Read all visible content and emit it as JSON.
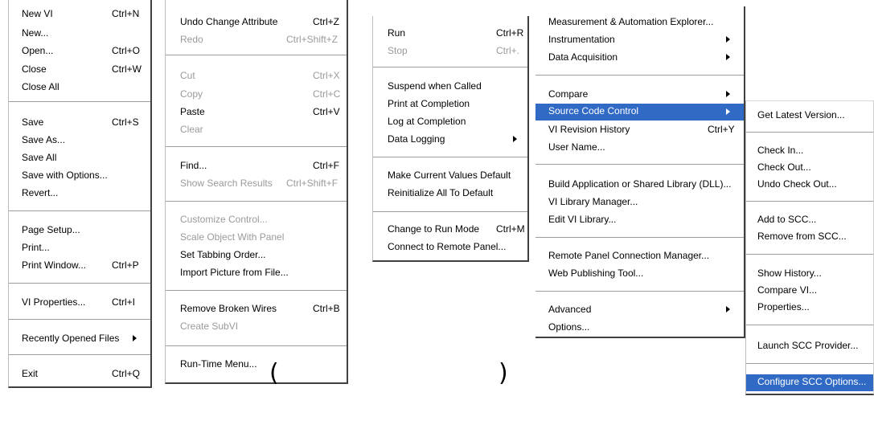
{
  "menus": {
    "file": {
      "items": [
        {
          "label": "New VI",
          "shortcut": "Ctrl+N"
        },
        {
          "label": "New...",
          "shortcut": ""
        },
        {
          "label": "Open...",
          "shortcut": "Ctrl+O"
        },
        {
          "label": "Close",
          "shortcut": "Ctrl+W"
        },
        {
          "label": "Close All",
          "shortcut": ""
        },
        {
          "label": "Save",
          "shortcut": "Ctrl+S"
        },
        {
          "label": "Save As...",
          "shortcut": ""
        },
        {
          "label": "Save All",
          "shortcut": ""
        },
        {
          "label": "Save with Options...",
          "shortcut": ""
        },
        {
          "label": "Revert...",
          "shortcut": ""
        },
        {
          "label": "Page Setup...",
          "shortcut": ""
        },
        {
          "label": "Print...",
          "shortcut": ""
        },
        {
          "label": "Print Window...",
          "shortcut": "Ctrl+P"
        },
        {
          "label": "VI Properties...",
          "shortcut": "Ctrl+I"
        },
        {
          "label": "Recently Opened Files",
          "shortcut": ""
        },
        {
          "label": "Exit",
          "shortcut": "Ctrl+Q"
        }
      ]
    },
    "edit": {
      "items": [
        {
          "label": "Undo Change Attribute",
          "shortcut": "Ctrl+Z"
        },
        {
          "label": "Redo",
          "shortcut": "Ctrl+Shift+Z"
        },
        {
          "label": "Cut",
          "shortcut": "Ctrl+X"
        },
        {
          "label": "Copy",
          "shortcut": "Ctrl+C"
        },
        {
          "label": "Paste",
          "shortcut": "Ctrl+V"
        },
        {
          "label": "Clear",
          "shortcut": ""
        },
        {
          "label": "Find...",
          "shortcut": "Ctrl+F"
        },
        {
          "label": "Show Search Results",
          "shortcut": "Ctrl+Shift+F"
        },
        {
          "label": "Customize Control...",
          "shortcut": ""
        },
        {
          "label": "Scale Object With Panel",
          "shortcut": ""
        },
        {
          "label": "Set Tabbing Order...",
          "shortcut": ""
        },
        {
          "label": "Import Picture from File...",
          "shortcut": ""
        },
        {
          "label": "Remove Broken Wires",
          "shortcut": "Ctrl+B"
        },
        {
          "label": "Create SubVI",
          "shortcut": ""
        },
        {
          "label": "Run-Time Menu...",
          "shortcut": ""
        }
      ]
    },
    "operate": {
      "items": [
        {
          "label": "Run",
          "shortcut": "Ctrl+R"
        },
        {
          "label": "Stop",
          "shortcut": "Ctrl+."
        },
        {
          "label": "Suspend when Called",
          "shortcut": ""
        },
        {
          "label": "Print at Completion",
          "shortcut": ""
        },
        {
          "label": "Log at Completion",
          "shortcut": ""
        },
        {
          "label": "Data Logging",
          "shortcut": ""
        },
        {
          "label": "Make Current Values Default",
          "shortcut": ""
        },
        {
          "label": "Reinitialize All To Default",
          "shortcut": ""
        },
        {
          "label": "Change to Run Mode",
          "shortcut": "Ctrl+M"
        },
        {
          "label": "Connect to Remote Panel...",
          "shortcut": ""
        }
      ]
    },
    "tools": {
      "items": [
        {
          "label": "Measurement & Automation Explorer...",
          "shortcut": ""
        },
        {
          "label": "Instrumentation",
          "shortcut": ""
        },
        {
          "label": "Data Acquisition",
          "shortcut": ""
        },
        {
          "label": "Compare",
          "shortcut": ""
        },
        {
          "label": "Source Code Control",
          "shortcut": ""
        },
        {
          "label": "VI Revision History",
          "shortcut": "Ctrl+Y"
        },
        {
          "label": "User Name...",
          "shortcut": ""
        },
        {
          "label": "Build Application or Shared Library (DLL)...",
          "shortcut": ""
        },
        {
          "label": "VI Library Manager...",
          "shortcut": ""
        },
        {
          "label": "Edit VI Library...",
          "shortcut": ""
        },
        {
          "label": "Remote Panel Connection Manager...",
          "shortcut": ""
        },
        {
          "label": "Web Publishing Tool...",
          "shortcut": ""
        },
        {
          "label": "Advanced",
          "shortcut": ""
        },
        {
          "label": "Options...",
          "shortcut": ""
        }
      ]
    },
    "scc": {
      "items": [
        {
          "label": "Get Latest Version...",
          "shortcut": ""
        },
        {
          "label": "Check In...",
          "shortcut": ""
        },
        {
          "label": "Check Out...",
          "shortcut": ""
        },
        {
          "label": "Undo Check Out...",
          "shortcut": ""
        },
        {
          "label": "Add to SCC...",
          "shortcut": ""
        },
        {
          "label": "Remove from SCC...",
          "shortcut": ""
        },
        {
          "label": "Show History...",
          "shortcut": ""
        },
        {
          "label": "Compare VI...",
          "shortcut": ""
        },
        {
          "label": "Properties...",
          "shortcut": ""
        },
        {
          "label": "Launch SCC Provider...",
          "shortcut": ""
        },
        {
          "label": "Configure SCC Options...",
          "shortcut": ""
        }
      ]
    }
  },
  "caption": {
    "open": "(",
    "close": ")"
  },
  "colors": {
    "highlight": "#316ac5",
    "disabled": "#9a9a9a"
  }
}
